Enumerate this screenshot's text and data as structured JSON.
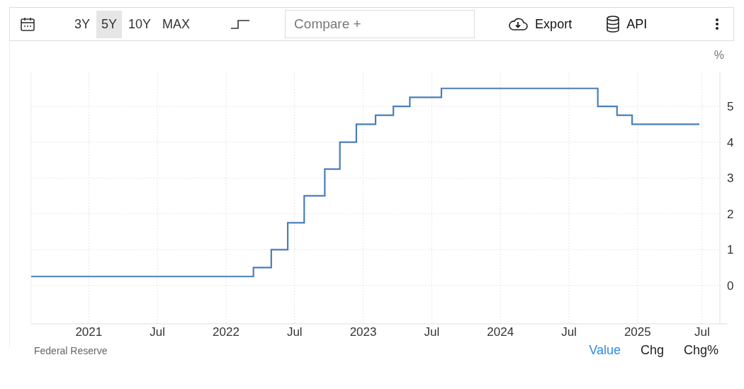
{
  "toolbar": {
    "ranges": [
      {
        "label": "3Y",
        "selected": false
      },
      {
        "label": "5Y",
        "selected": true
      },
      {
        "label": "10Y",
        "selected": false
      },
      {
        "label": "MAX",
        "selected": false
      }
    ],
    "compare": {
      "placeholder": "Compare +"
    },
    "export": "Export",
    "api": "API"
  },
  "chart": {
    "unit": "%",
    "chart_data": {
      "type": "line",
      "x": [
        2020.58,
        2022.2,
        2022.2,
        2022.33,
        2022.33,
        2022.45,
        2022.45,
        2022.57,
        2022.57,
        2022.72,
        2022.72,
        2022.83,
        2022.83,
        2022.95,
        2022.95,
        2023.09,
        2023.09,
        2023.22,
        2023.22,
        2023.34,
        2023.34,
        2023.57,
        2023.57,
        2024.71,
        2024.71,
        2024.85,
        2024.85,
        2024.96,
        2024.96,
        2025.45
      ],
      "series": [
        {
          "color": "#4a7ebb",
          "values": [
            0.25,
            0.25,
            0.5,
            0.5,
            1.0,
            1.0,
            1.75,
            1.75,
            2.5,
            2.5,
            3.25,
            3.25,
            4.0,
            4.0,
            4.5,
            4.5,
            4.75,
            4.75,
            5.0,
            5.0,
            5.25,
            5.25,
            5.5,
            5.5,
            5.0,
            5.0,
            4.75,
            4.75,
            4.5,
            4.5
          ]
        }
      ],
      "grid": true,
      "xlim": [
        2020.58,
        2025.6
      ],
      "ylim": [
        -1.07,
        5.95
      ],
      "xticks": [
        {
          "value": 2021,
          "label": "2021"
        },
        {
          "value": 2021.5,
          "label": "Jul"
        },
        {
          "value": 2022,
          "label": "2022"
        },
        {
          "value": 2022.5,
          "label": "Jul"
        },
        {
          "value": 2023,
          "label": "2023"
        },
        {
          "value": 2023.5,
          "label": "Jul"
        },
        {
          "value": 2024,
          "label": "2024"
        },
        {
          "value": 2024.5,
          "label": "Jul"
        },
        {
          "value": 2025,
          "label": "2025"
        },
        {
          "value": 2025.47,
          "label": "Jul"
        }
      ],
      "yticks": [
        0,
        1,
        2,
        3,
        4,
        5
      ]
    }
  },
  "footer": {
    "source": "Federal Reserve",
    "views": [
      {
        "label": "Value",
        "selected": true
      },
      {
        "label": "Chg",
        "selected": false
      },
      {
        "label": "Chg%",
        "selected": false
      }
    ]
  }
}
